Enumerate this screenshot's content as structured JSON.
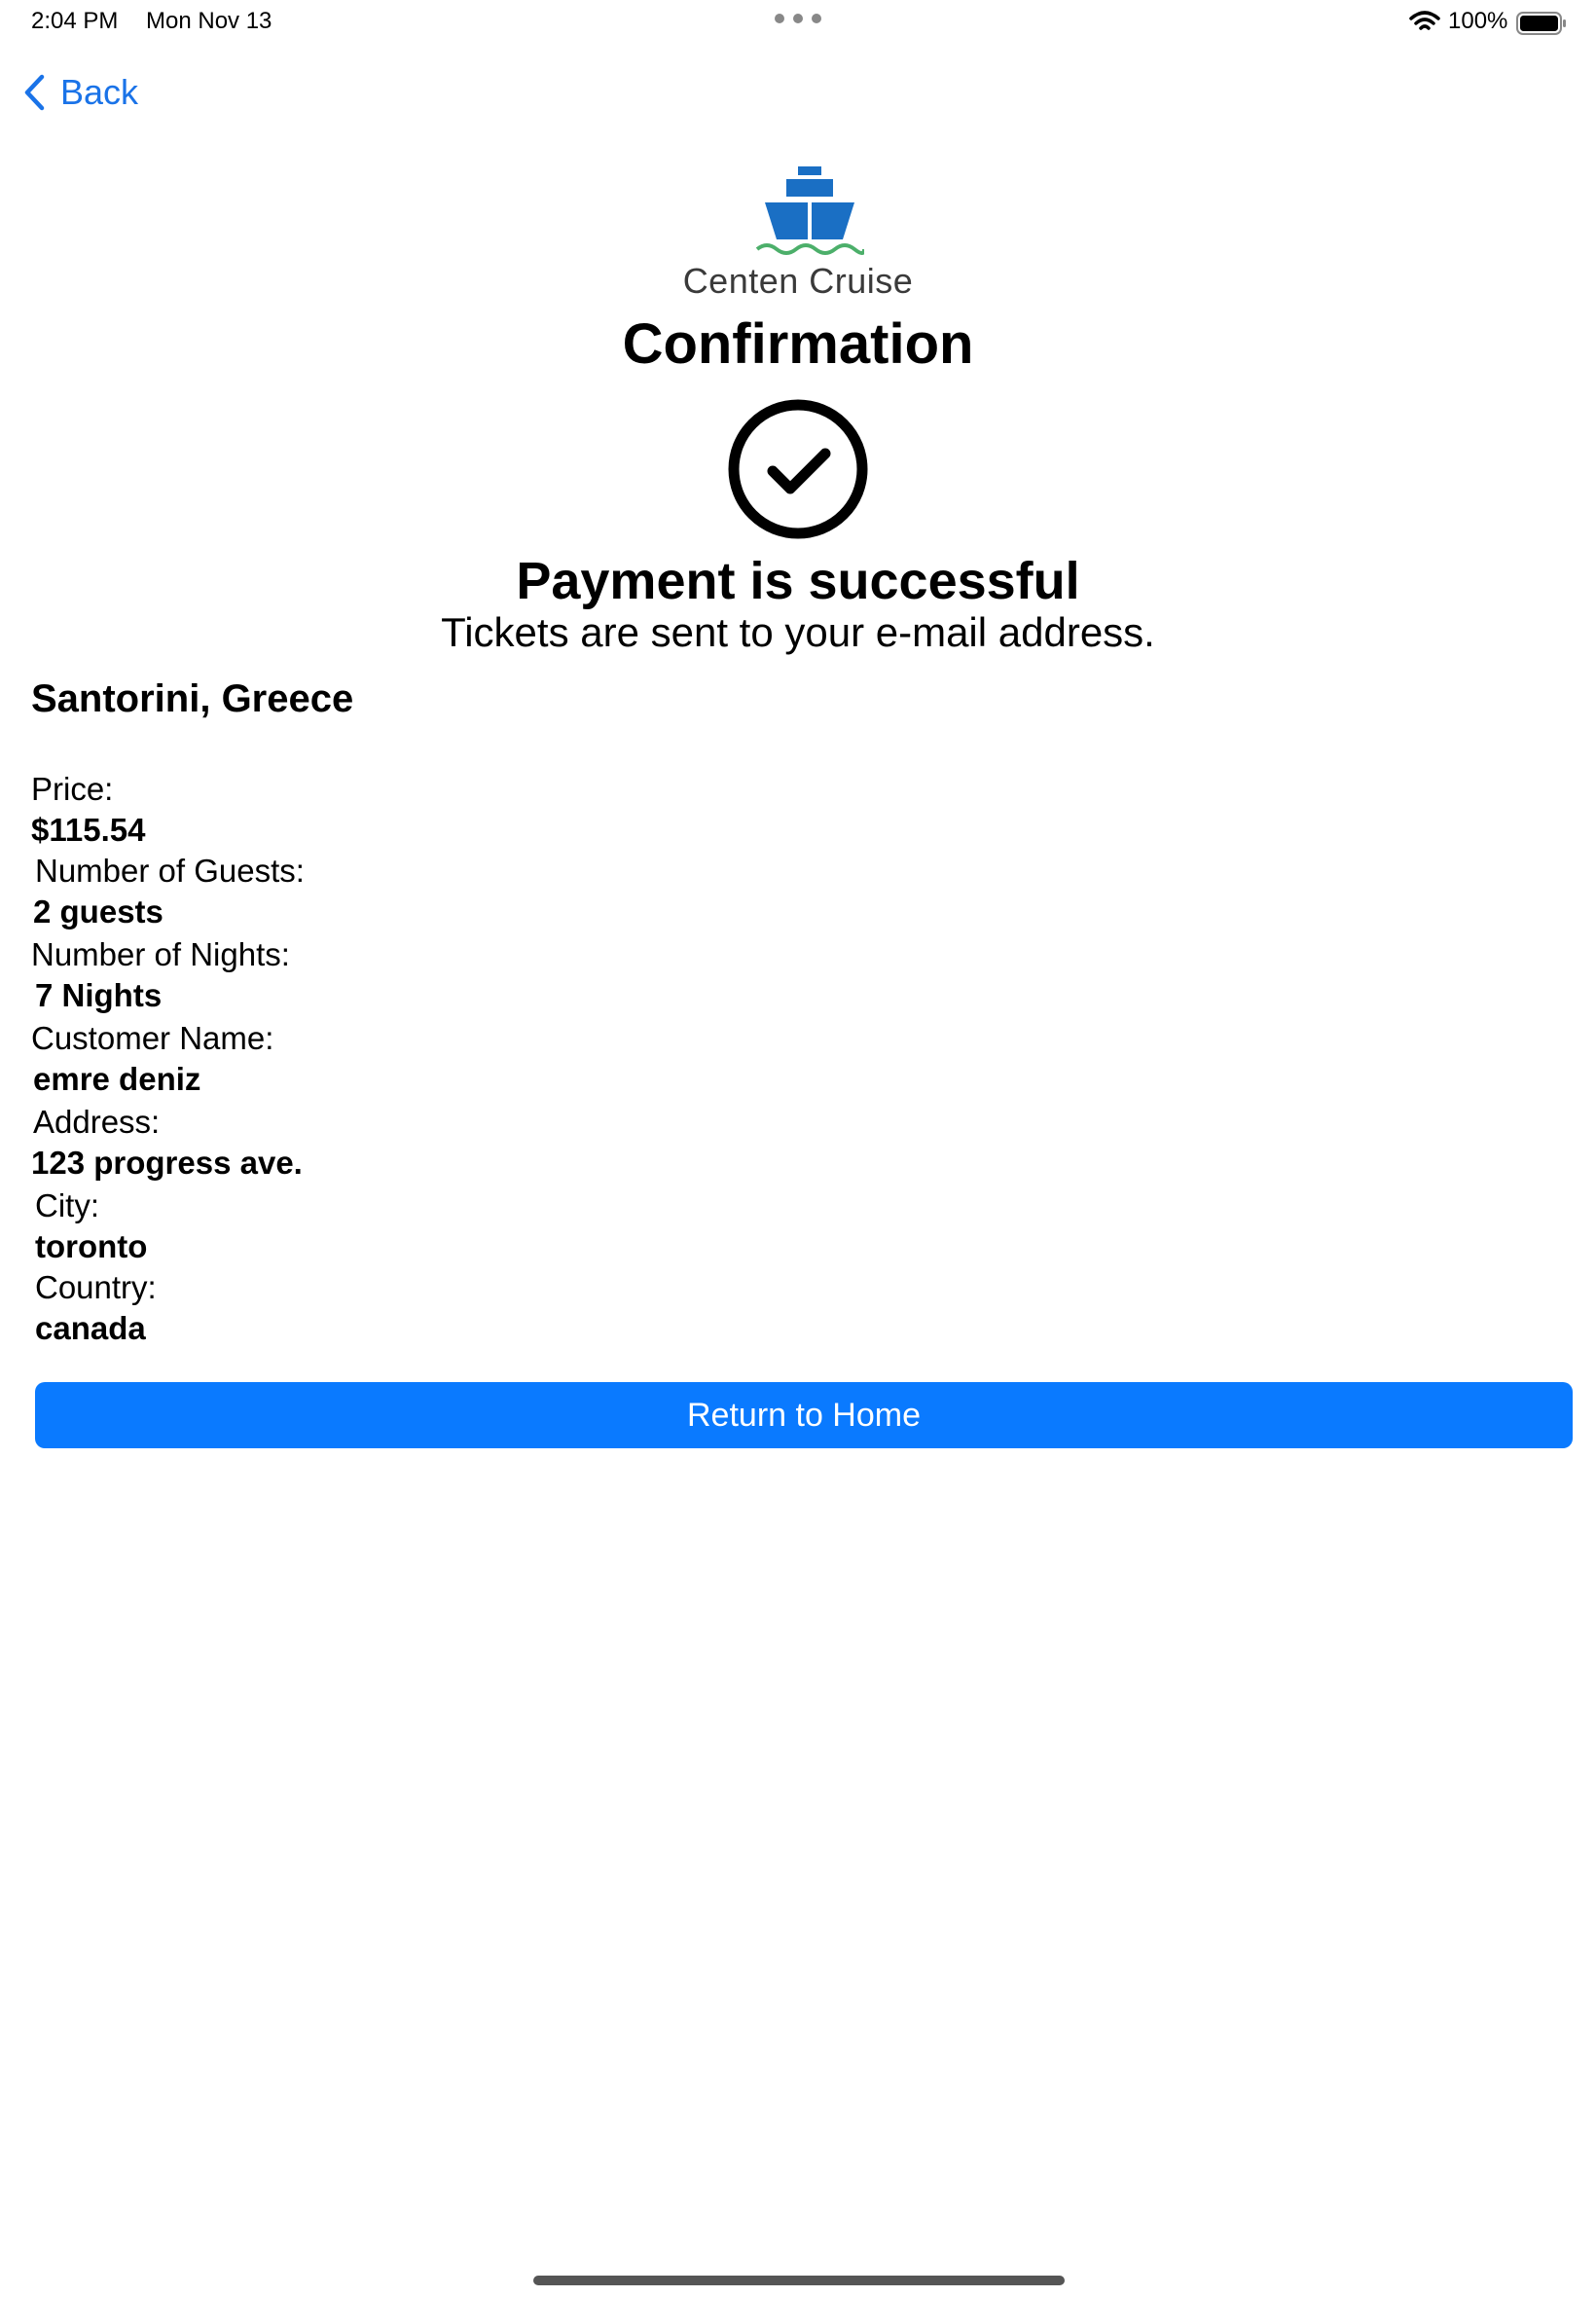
{
  "status_bar": {
    "time": "2:04 PM",
    "date": "Mon Nov 13",
    "battery": "100%"
  },
  "nav": {
    "back_label": "Back"
  },
  "brand": {
    "name": "Centen Cruise"
  },
  "page": {
    "title": "Confirmation",
    "success_message": "Payment is successful",
    "subtitle": "Tickets are sent to your e-mail address."
  },
  "booking": {
    "destination": "Santorini, Greece",
    "price_label": "Price:",
    "price_value": "$115.54",
    "guests_label": "Number of Guests:",
    "guests_value": "2 guests",
    "nights_label": "Number of Nights:",
    "nights_value": "7 Nights",
    "customer_label": "Customer Name:",
    "customer_value": "emre deniz",
    "address_label": "Address:",
    "address_value": "123 progress ave.",
    "city_label": "City:",
    "city_value": "toronto",
    "country_label": "Country:",
    "country_value": "canada"
  },
  "actions": {
    "return_home": "Return to Home"
  },
  "colors": {
    "accent": "#0a7aff",
    "link": "#1a73e8",
    "logo_blue": "#1a6fc4",
    "logo_green": "#4caf6a"
  }
}
